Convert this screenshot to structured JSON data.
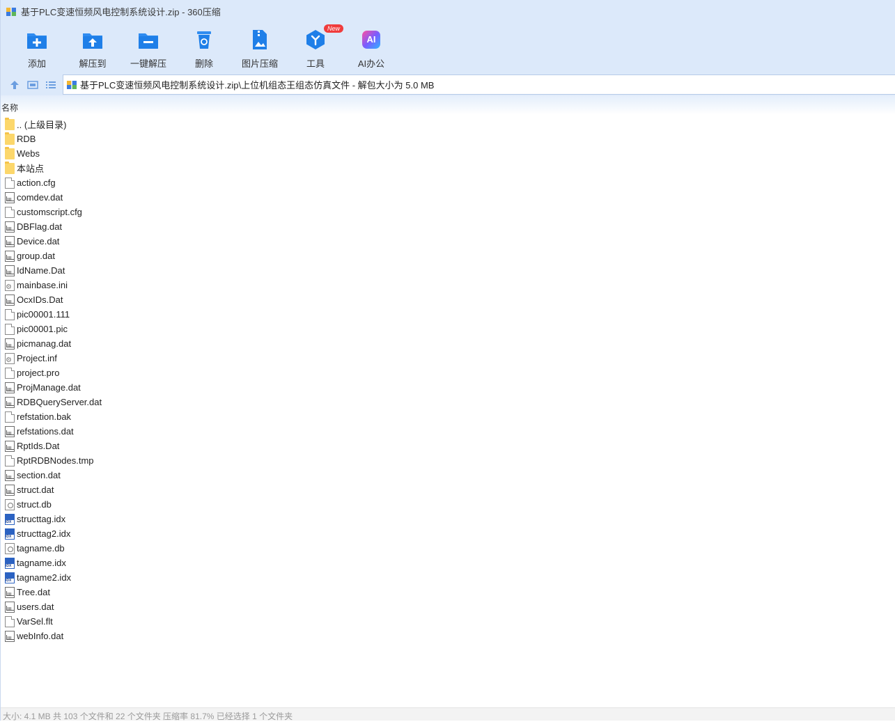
{
  "window": {
    "title": "基于PLC变速恒频风电控制系统设计.zip - 360压缩",
    "app_icon": "zip-archive-icon"
  },
  "toolbar": {
    "items": [
      {
        "label": "添加",
        "icon": "add-icon"
      },
      {
        "label": "解压到",
        "icon": "extract-to-icon"
      },
      {
        "label": "一键解压",
        "icon": "one-click-extract-icon"
      },
      {
        "label": "删除",
        "icon": "delete-icon"
      },
      {
        "label": "图片压缩",
        "icon": "image-compress-icon"
      },
      {
        "label": "工具",
        "icon": "tools-icon",
        "badge": "New"
      },
      {
        "label": "AI办公",
        "icon": "ai-office-icon",
        "icon_text": "AI"
      }
    ]
  },
  "nav": {
    "up_icon": "up-arrow-icon",
    "view_icon": "thumbnail-view-icon",
    "list_icon": "list-view-icon"
  },
  "path": {
    "text": "基于PLC变速恒频风电控制系统设计.zip\\上位机组态王组态仿真文件 - 解包大小为 5.0 MB"
  },
  "list": {
    "column_header": "名称",
    "items": [
      {
        "name": ".. (上级目录)",
        "type": "folder"
      },
      {
        "name": "RDB",
        "type": "folder"
      },
      {
        "name": "Webs",
        "type": "folder"
      },
      {
        "name": "本站点",
        "type": "folder"
      },
      {
        "name": "action.cfg",
        "type": "blank"
      },
      {
        "name": "comdev.dat",
        "type": "data"
      },
      {
        "name": "customscript.cfg",
        "type": "blank"
      },
      {
        "name": "DBFlag.dat",
        "type": "data"
      },
      {
        "name": "Device.dat",
        "type": "data"
      },
      {
        "name": "group.dat",
        "type": "data"
      },
      {
        "name": "IdName.Dat",
        "type": "data"
      },
      {
        "name": "mainbase.ini",
        "type": "gear"
      },
      {
        "name": "OcxIDs.Dat",
        "type": "data"
      },
      {
        "name": "pic00001.111",
        "type": "blank"
      },
      {
        "name": "pic00001.pic",
        "type": "blank"
      },
      {
        "name": "picmanag.dat",
        "type": "data"
      },
      {
        "name": "Project.inf",
        "type": "gear"
      },
      {
        "name": "project.pro",
        "type": "blank"
      },
      {
        "name": "ProjManage.dat",
        "type": "data"
      },
      {
        "name": "RDBQueryServer.dat",
        "type": "data"
      },
      {
        "name": "refstation.bak",
        "type": "blank"
      },
      {
        "name": "refstations.dat",
        "type": "data"
      },
      {
        "name": "RptIds.Dat",
        "type": "data"
      },
      {
        "name": "RptRDBNodes.tmp",
        "type": "blank"
      },
      {
        "name": "section.dat",
        "type": "data"
      },
      {
        "name": "struct.dat",
        "type": "data"
      },
      {
        "name": "struct.db",
        "type": "db"
      },
      {
        "name": "structtag.idx",
        "type": "idx"
      },
      {
        "name": "structtag2.idx",
        "type": "idx"
      },
      {
        "name": "tagname.db",
        "type": "db"
      },
      {
        "name": "tagname.idx",
        "type": "idx"
      },
      {
        "name": "tagname2.idx",
        "type": "idx"
      },
      {
        "name": "Tree.dat",
        "type": "data"
      },
      {
        "name": "users.dat",
        "type": "data"
      },
      {
        "name": "VarSel.flt",
        "type": "blank"
      },
      {
        "name": "webInfo.dat",
        "type": "data"
      }
    ]
  },
  "status": {
    "text": "大小: 4.1 MB 共 103 个文件和 22 个文件夹 压缩率 81.7% 已经选择 1 个文件夹"
  }
}
